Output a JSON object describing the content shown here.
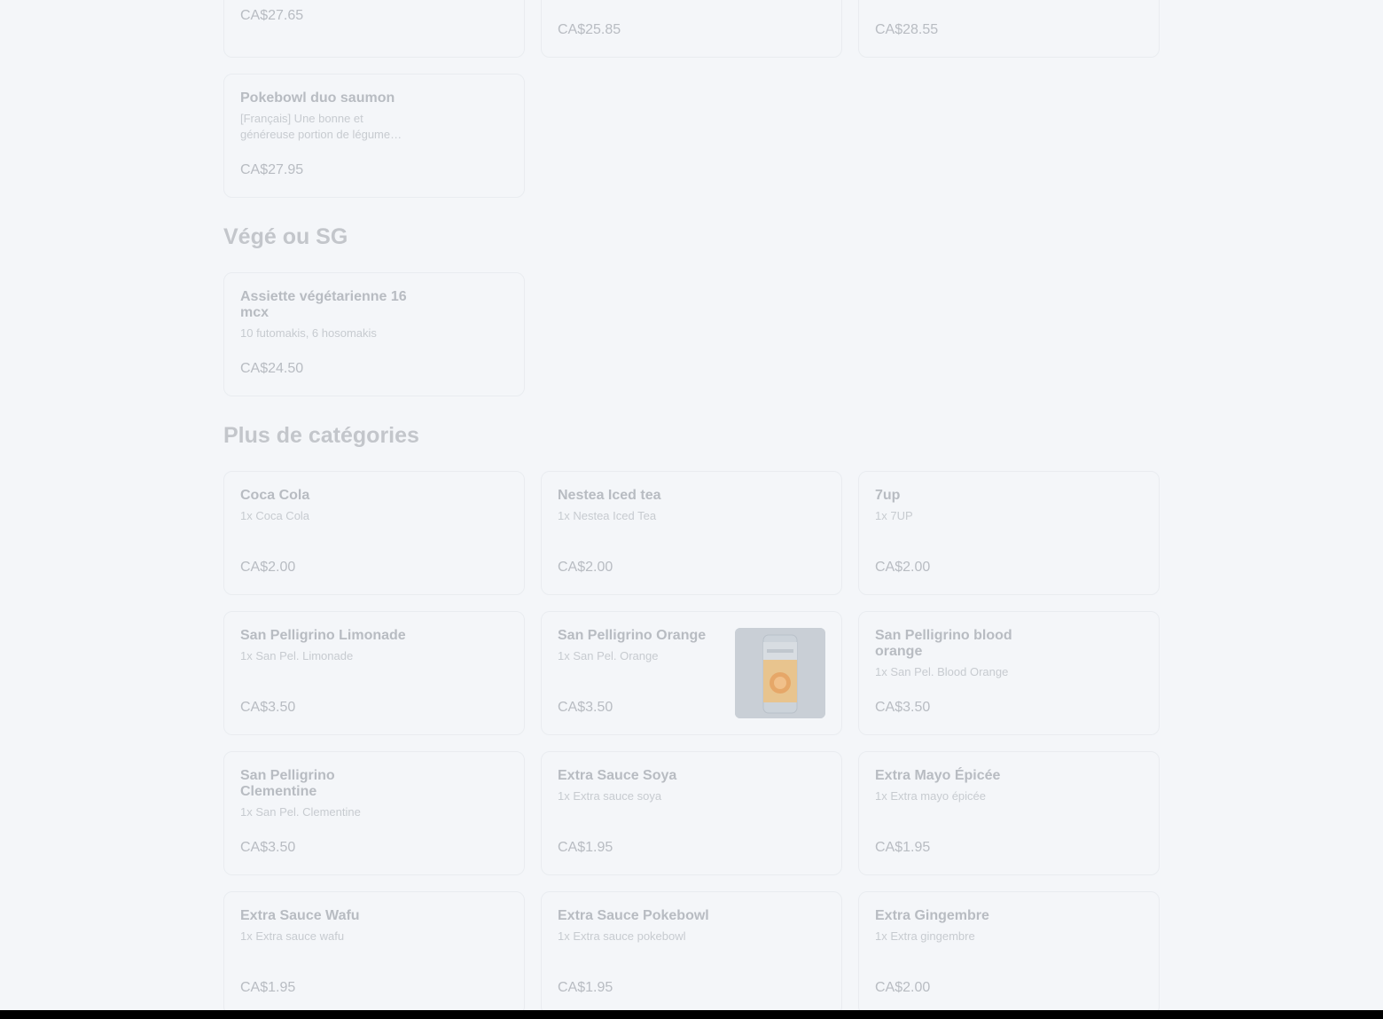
{
  "top_prices": {
    "c1": "CA$27.65",
    "c2": "CA$25.85",
    "c3": "CA$28.55"
  },
  "poke": {
    "name": "Pokebowl duo saumon",
    "desc": "[Français] Une bonne et généreuse portion de légume…",
    "price": "CA$27.95"
  },
  "vege": {
    "title": "Végé ou SG",
    "item": {
      "name": "Assiette végétarienne 16 mcx",
      "desc": "10 futomakis, 6 hosomakis",
      "price": "CA$24.50"
    }
  },
  "more": {
    "title": "Plus de catégories",
    "items": [
      {
        "name": "Coca Cola",
        "desc": "1x Coca Cola",
        "price": "CA$2.00"
      },
      {
        "name": "Nestea Iced tea",
        "desc": "1x Nestea Iced Tea",
        "price": "CA$2.00"
      },
      {
        "name": "7up",
        "desc": "1x 7UP",
        "price": "CA$2.00"
      },
      {
        "name": "San Pelligrino Limonade",
        "desc": "1x San Pel. Limonade",
        "price": "CA$3.50"
      },
      {
        "name": "San Pelligrino Orange",
        "desc": "1x San Pel. Orange",
        "price": "CA$3.50"
      },
      {
        "name": "San Pelligrino blood orange",
        "desc": "1x San Pel. Blood Orange",
        "price": "CA$3.50"
      },
      {
        "name": "San Pelligrino Clementine",
        "desc": "1x San Pel. Clementine",
        "price": "CA$3.50"
      },
      {
        "name": "Extra Sauce Soya",
        "desc": "1x Extra sauce soya",
        "price": "CA$1.95"
      },
      {
        "name": "Extra Mayo Épicée",
        "desc": "1x Extra mayo épicée",
        "price": "CA$1.95"
      },
      {
        "name": "Extra Sauce Wafu",
        "desc": "1x Extra sauce wafu",
        "price": "CA$1.95"
      },
      {
        "name": "Extra Sauce Pokebowl",
        "desc": "1x Extra sauce pokebowl",
        "price": "CA$1.95"
      },
      {
        "name": "Extra Gingembre",
        "desc": "1x Extra gingembre",
        "price": "CA$2.00"
      }
    ]
  }
}
